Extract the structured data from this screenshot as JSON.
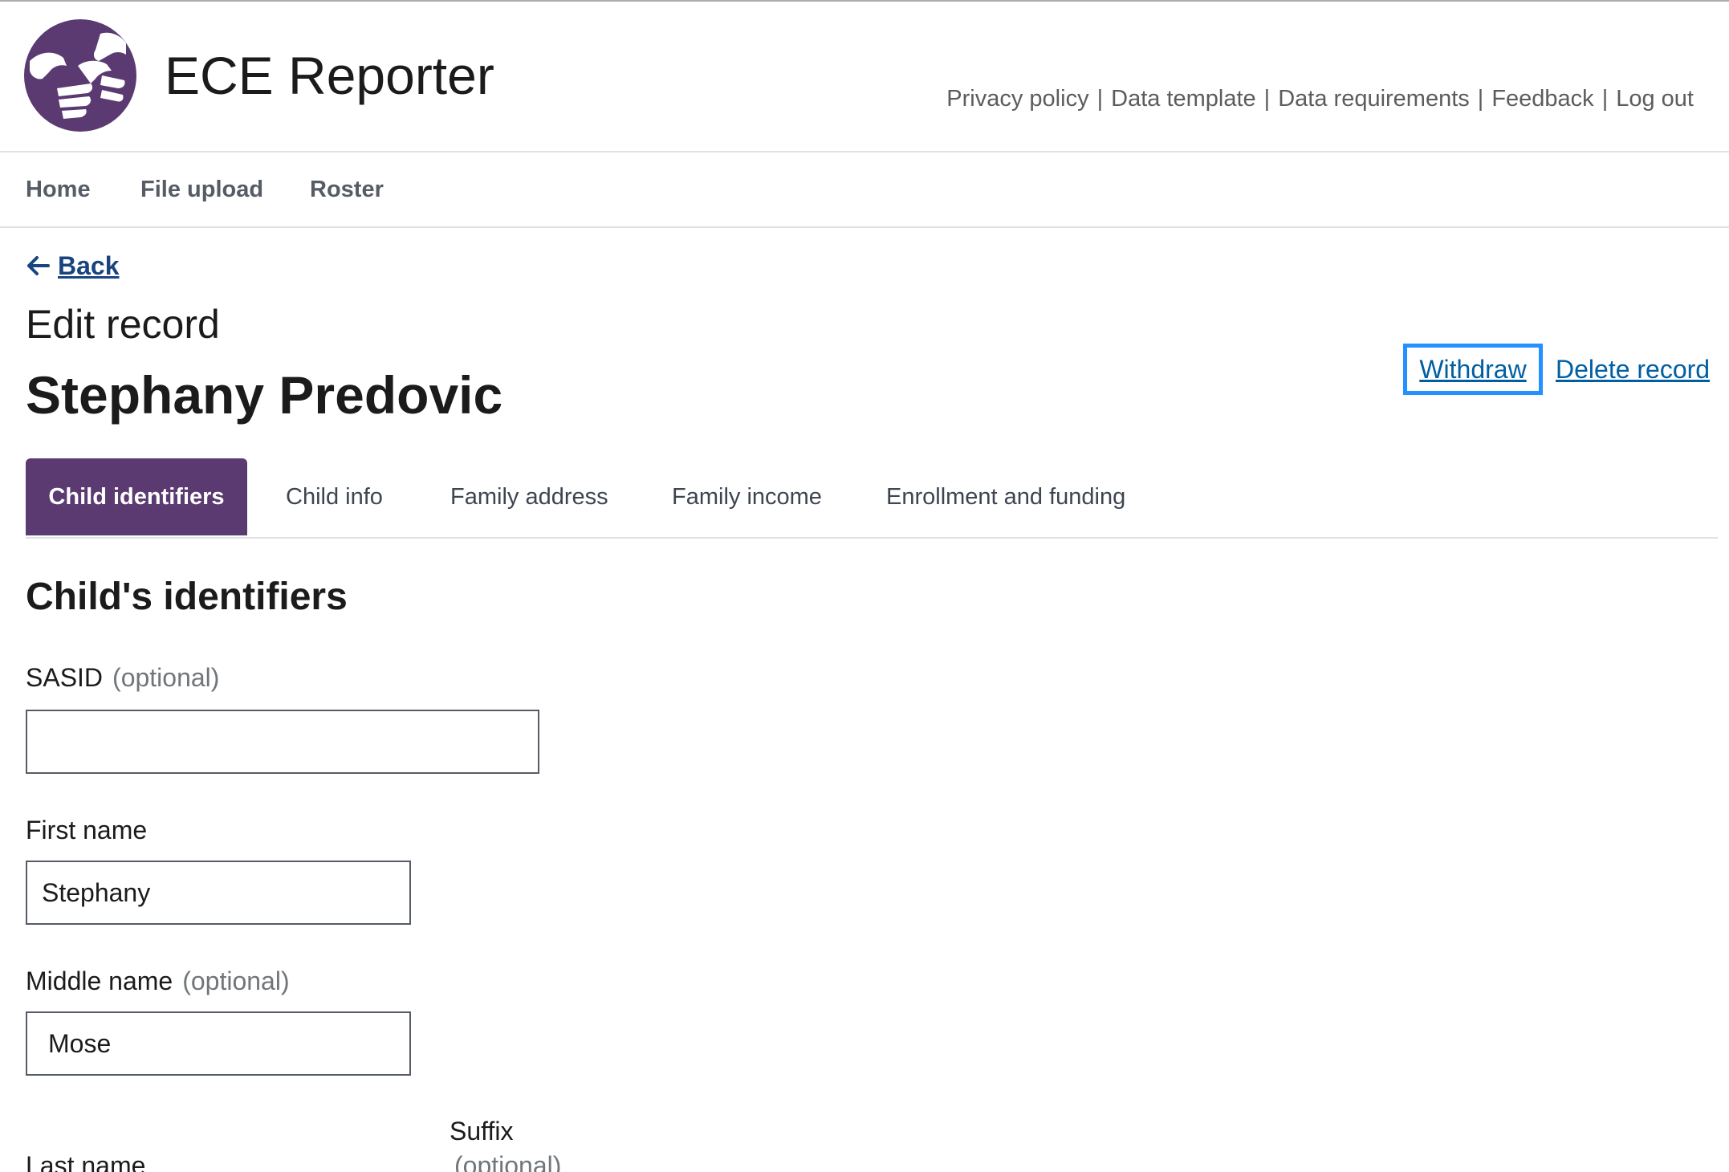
{
  "header": {
    "app_title": "ECE Reporter",
    "utility_links": [
      {
        "label": "Privacy policy"
      },
      {
        "label": "Data template"
      },
      {
        "label": "Data requirements"
      },
      {
        "label": "Feedback"
      },
      {
        "label": "Log out"
      }
    ],
    "separator": "|"
  },
  "nav": {
    "items": [
      {
        "label": "Home"
      },
      {
        "label": "File upload"
      },
      {
        "label": "Roster"
      }
    ]
  },
  "back": {
    "label": "Back",
    "icon": "arrow-left-icon"
  },
  "page": {
    "heading": "Edit record",
    "child_name": "Stephany Predovic"
  },
  "actions": {
    "withdraw_label": "Withdraw",
    "delete_label": "Delete record"
  },
  "tabs": [
    {
      "label": "Child identifiers",
      "active": true
    },
    {
      "label": "Child info",
      "active": false
    },
    {
      "label": "Family address",
      "active": false
    },
    {
      "label": "Family income",
      "active": false
    },
    {
      "label": "Enrollment and funding",
      "active": false
    }
  ],
  "form": {
    "section_title": "Child's identifiers",
    "sasid": {
      "label": "SASID",
      "optional": "(optional)",
      "value": ""
    },
    "first_name": {
      "label": "First name",
      "value": "Stephany"
    },
    "middle_name": {
      "label": "Middle name",
      "optional": "(optional)",
      "value": "Mose"
    },
    "last_name": {
      "label": "Last name"
    },
    "suffix": {
      "label": "Suffix",
      "optional": "(optional)"
    }
  },
  "colors": {
    "brand": "#5b3a72",
    "link": "#005ea2",
    "focus": "#2491ff"
  }
}
